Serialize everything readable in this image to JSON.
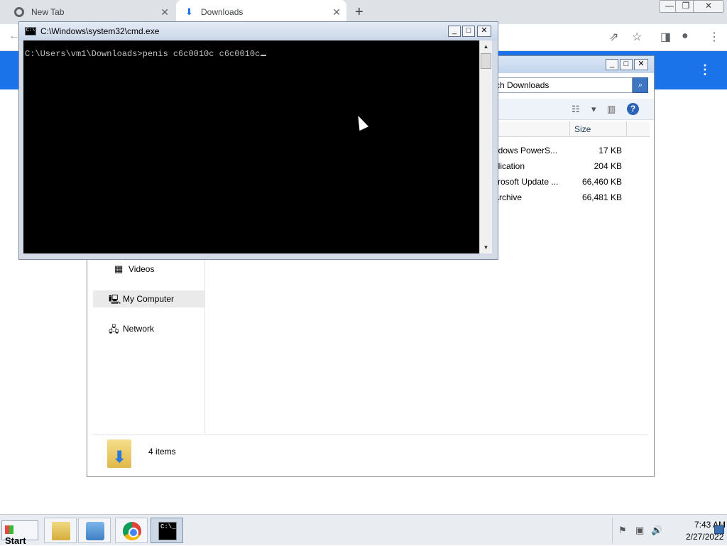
{
  "browser": {
    "tabs": [
      {
        "label": "New Tab",
        "close": "✕"
      },
      {
        "label": "Downloads",
        "close": "✕"
      }
    ],
    "new_tab": "+",
    "window_controls": {
      "minimize": "—",
      "maximize": "❐",
      "close": "✕"
    },
    "toolbar_icons": [
      "share-icon",
      "star-icon",
      "sidebar-icon",
      "profile-icon",
      "kebab-icon"
    ],
    "accent": "#1a73e8"
  },
  "explorer": {
    "search_text": "ch Downloads",
    "columns": [
      "pe",
      "Size"
    ],
    "rows": [
      {
        "type": "ndows PowerS...",
        "size": "17 KB"
      },
      {
        "type": "plication",
        "size": "204 KB"
      },
      {
        "type": "crosoft Update ...",
        "size": "66,460 KB"
      },
      {
        "type": " Archive",
        "size": "66,481 KB"
      }
    ],
    "nav": [
      {
        "label": "Videos"
      },
      {
        "label": "My Computer"
      },
      {
        "label": "Network"
      }
    ],
    "status_count": "4 items"
  },
  "cmd": {
    "title": "C:\\Windows\\system32\\cmd.exe",
    "prompt": "C:\\Users\\vm1\\Downloads>",
    "command": "penis c6c0010c c6c0010c",
    "icon_text": "C:\\"
  },
  "taskbar": {
    "start_label": "Start",
    "time": "7:43 AM",
    "date": "2/27/2022",
    "cmd_icon_text": "C:\\_"
  }
}
